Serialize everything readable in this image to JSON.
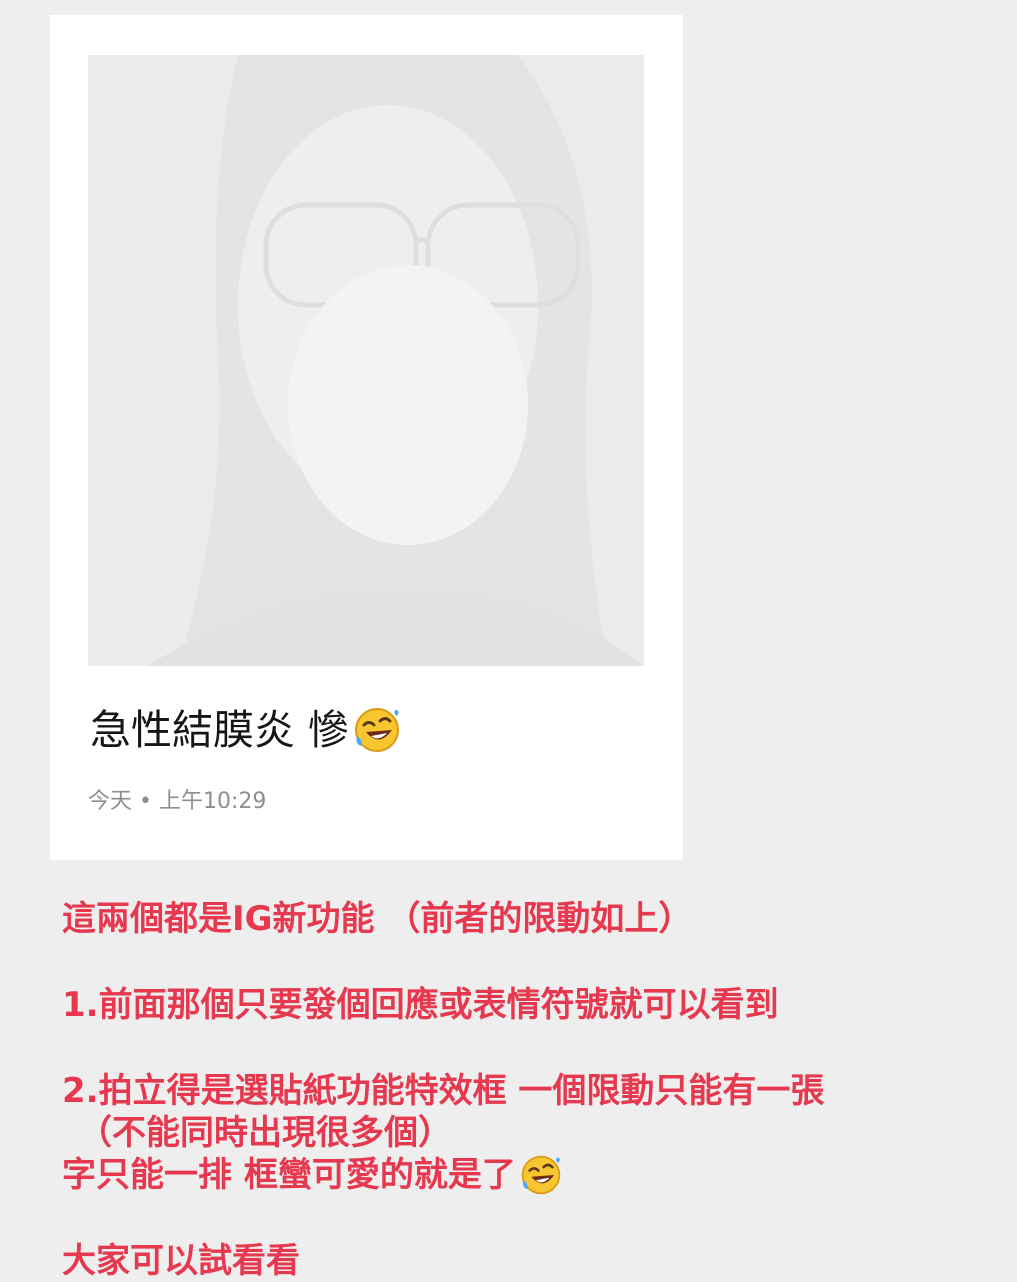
{
  "post": {
    "caption": "急性結膜炎 慘",
    "caption_emoji": "rofl-emoji",
    "timestamp": "今天 • 上午10:29"
  },
  "note": {
    "line1": "這兩個都是IG新功能 （前者的限動如上）",
    "line2": "1.前面那個只要發個回應或表情符號就可以看到",
    "line3": "2.拍立得是選貼紙功能特效框 一個限動只能有一張",
    "line4": "（不能同時出現很多個）",
    "line5": "字只能一排 框蠻可愛的就是了",
    "line6": "大家可以試看看"
  },
  "colors": {
    "background": "#efeeee",
    "card": "#ffffff",
    "note_text": "#e6394f",
    "caption_text": "#161616",
    "meta_text": "#8e8e8e"
  }
}
